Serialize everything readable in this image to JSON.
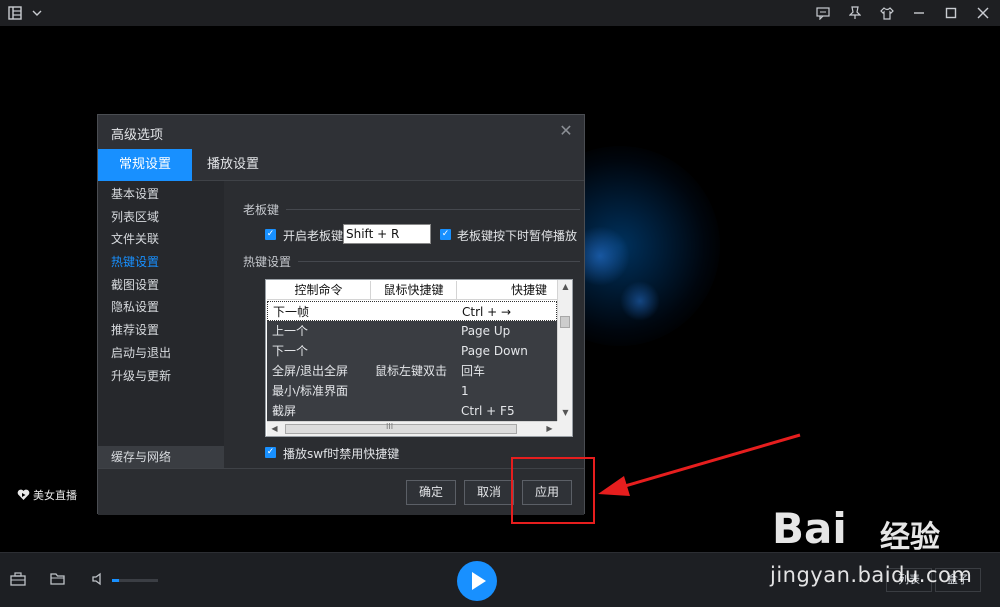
{
  "titlebar": {
    "icons": [
      "list-layout-icon",
      "chevron-down-icon",
      "feedback-icon",
      "pin-icon",
      "skin-icon",
      "minimize-icon",
      "maximize-icon",
      "close-icon"
    ]
  },
  "player": {
    "live_label": "美女直播"
  },
  "dialog": {
    "title": "高级选项",
    "tabs": [
      {
        "label": "常规设置",
        "active": true
      },
      {
        "label": "播放设置",
        "active": false
      }
    ],
    "nav": [
      {
        "label": "基本设置"
      },
      {
        "label": "列表区域"
      },
      {
        "label": "文件关联"
      },
      {
        "label": "热键设置",
        "active": true
      },
      {
        "label": "截图设置"
      },
      {
        "label": "隐私设置"
      },
      {
        "label": "推荐设置"
      },
      {
        "label": "启动与退出"
      },
      {
        "label": "升级与更新"
      }
    ],
    "nav_bottom": "缓存与网络",
    "boss_key": {
      "section_title": "老板键",
      "enable_label": "开启老板键",
      "enable_checked": true,
      "key_value": "Shift + R",
      "pause_label": "老板键按下时暂停播放",
      "pause_checked": true
    },
    "hotkeys": {
      "section_title": "热键设置",
      "columns": [
        "控制命令",
        "鼠标快捷键",
        "快捷键"
      ],
      "rows": [
        {
          "command": "下一帧",
          "mouse": "",
          "key": "Ctrl + →",
          "selected": true
        },
        {
          "command": "上一个",
          "mouse": "",
          "key": "Page Up"
        },
        {
          "command": "下一个",
          "mouse": "",
          "key": "Page Down"
        },
        {
          "command": "全屏/退出全屏",
          "mouse": "鼠标左键双击",
          "key": "回车"
        },
        {
          "command": "最小/标准界面",
          "mouse": "",
          "key": "1"
        },
        {
          "command": "截屏",
          "mouse": "",
          "key": "Ctrl + F5"
        }
      ],
      "scroll_hint": "III",
      "swf_label": "播放swf时禁用快捷键",
      "swf_checked": true
    },
    "buttons": {
      "ok": "确定",
      "cancel": "取消",
      "apply": "应用"
    }
  },
  "controls": {
    "volume_level": 0.15,
    "list_label": "列表",
    "box_label": "盒子"
  },
  "watermark": {
    "brand": "Bai",
    "brand_cn": "经验",
    "url": "jingyan.baidu.com"
  },
  "colors": {
    "accent": "#1890ff",
    "annotation": "#e61e1e",
    "dialog_bg": "#2b2d31"
  }
}
